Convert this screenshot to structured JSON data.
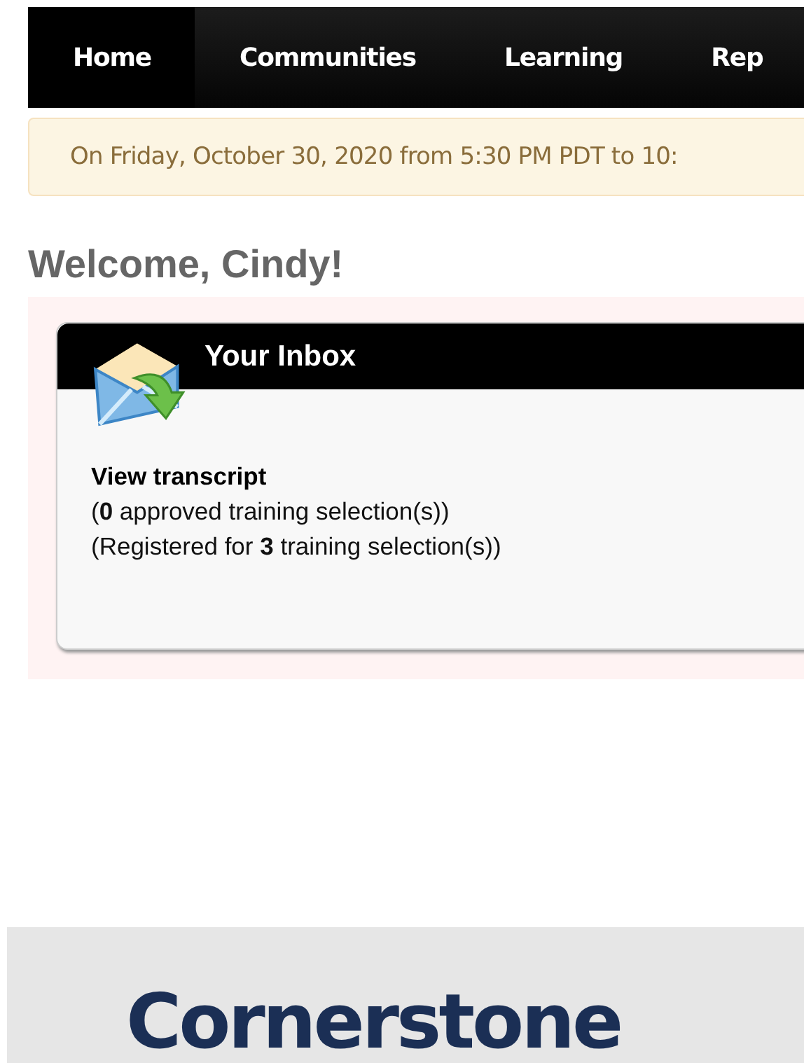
{
  "nav": {
    "tabs": [
      {
        "label": "Home",
        "selected": true
      },
      {
        "label": "Communities",
        "selected": false
      },
      {
        "label": "Learning",
        "selected": false
      },
      {
        "label": "Rep",
        "selected": false
      }
    ]
  },
  "banner": {
    "text": "On Friday, October 30, 2020 from 5:30 PM PDT to 10:"
  },
  "welcome": "Welcome, Cindy!",
  "inbox": {
    "title": "Your Inbox",
    "link": "View transcript",
    "lines": [
      "(**0** approved training selection(s))",
      "(Registered for **3** training selection(s))"
    ]
  },
  "footer": {
    "logo": "Cornerstone"
  }
}
